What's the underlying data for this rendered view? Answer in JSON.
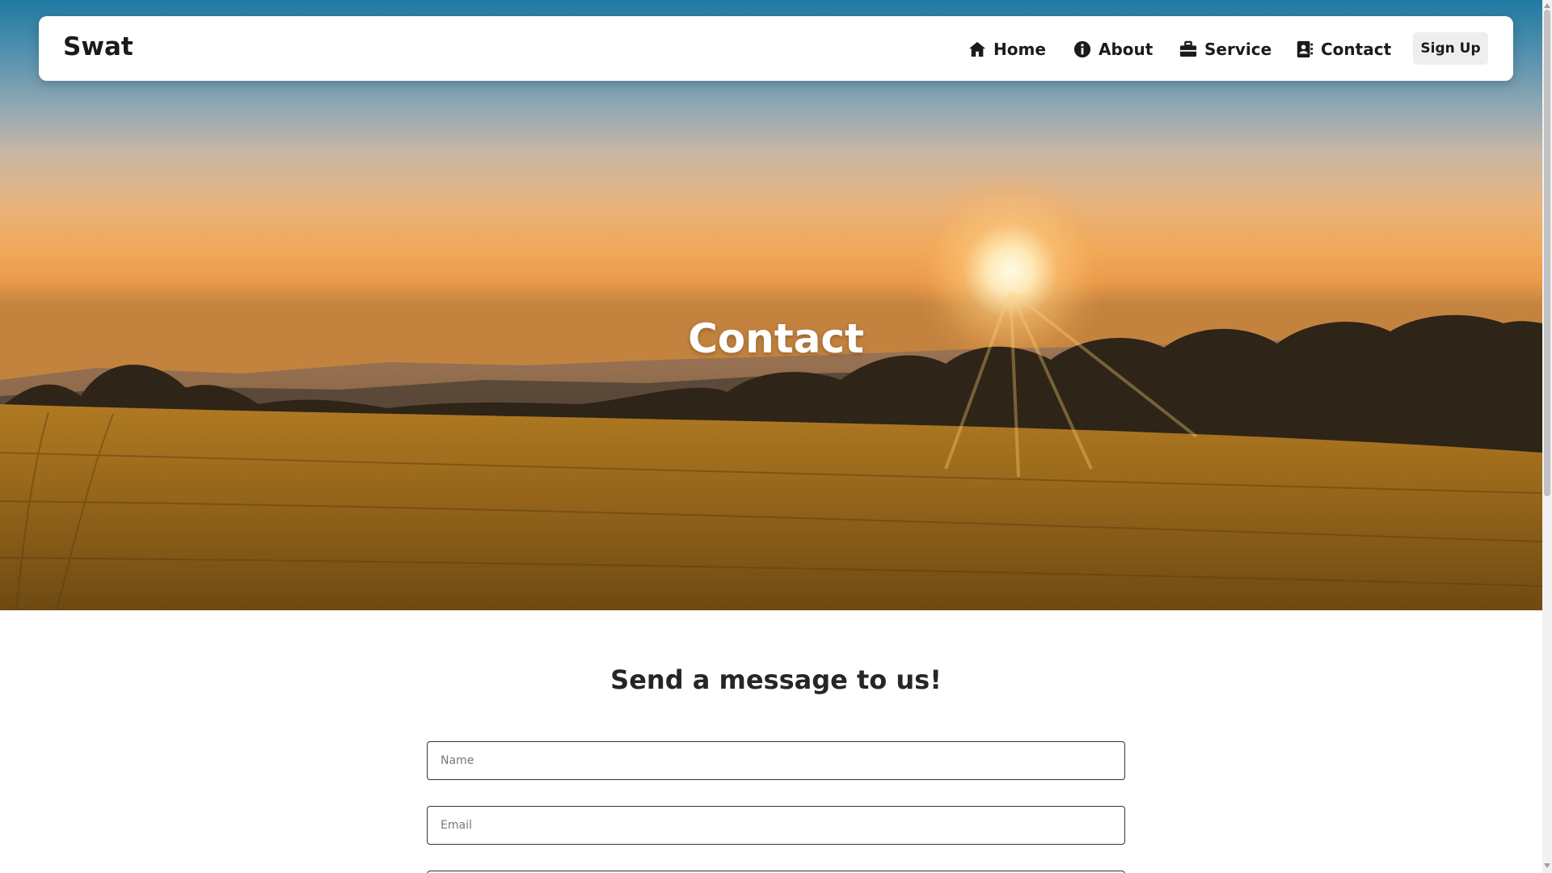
{
  "navbar": {
    "brand": "Swat",
    "items": [
      {
        "label": "Home",
        "icon": "home-icon"
      },
      {
        "label": "About",
        "icon": "info-icon"
      },
      {
        "label": "Service",
        "icon": "briefcase-icon"
      },
      {
        "label": "Contact",
        "icon": "address-book-icon"
      }
    ],
    "signup_label": "Sign Up"
  },
  "hero": {
    "title": "Contact"
  },
  "form": {
    "title": "Send a message to us!",
    "name_placeholder": "Name",
    "email_placeholder": "Email"
  }
}
